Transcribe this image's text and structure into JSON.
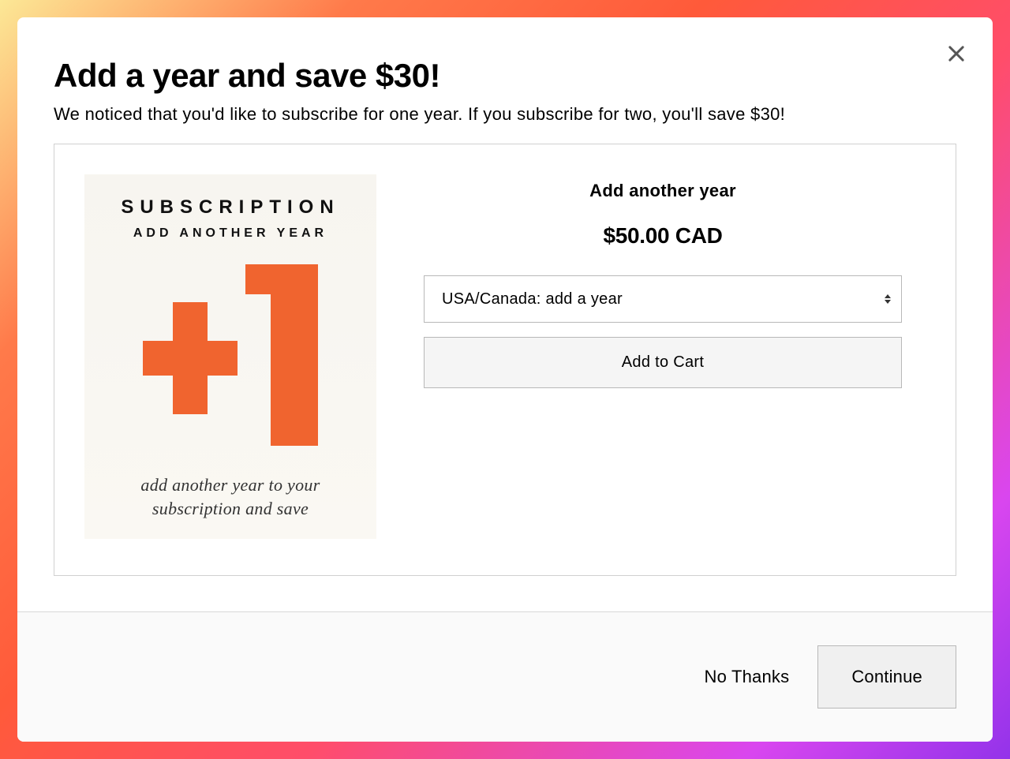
{
  "modal": {
    "title": "Add a year and save $30!",
    "subtitle": "We noticed that you'd like to subscribe for one year. If you subscribe for two, you'll save $30!"
  },
  "product_image": {
    "line1": "SUBSCRIPTION",
    "line2": "ADD ANOTHER YEAR",
    "line3": "add another year to your subscription and save"
  },
  "product": {
    "title": "Add another year",
    "price": "$50.00 CAD",
    "selected_option": "USA/Canada: add a year",
    "add_to_cart_label": "Add to Cart"
  },
  "footer": {
    "no_thanks_label": "No Thanks",
    "continue_label": "Continue"
  }
}
